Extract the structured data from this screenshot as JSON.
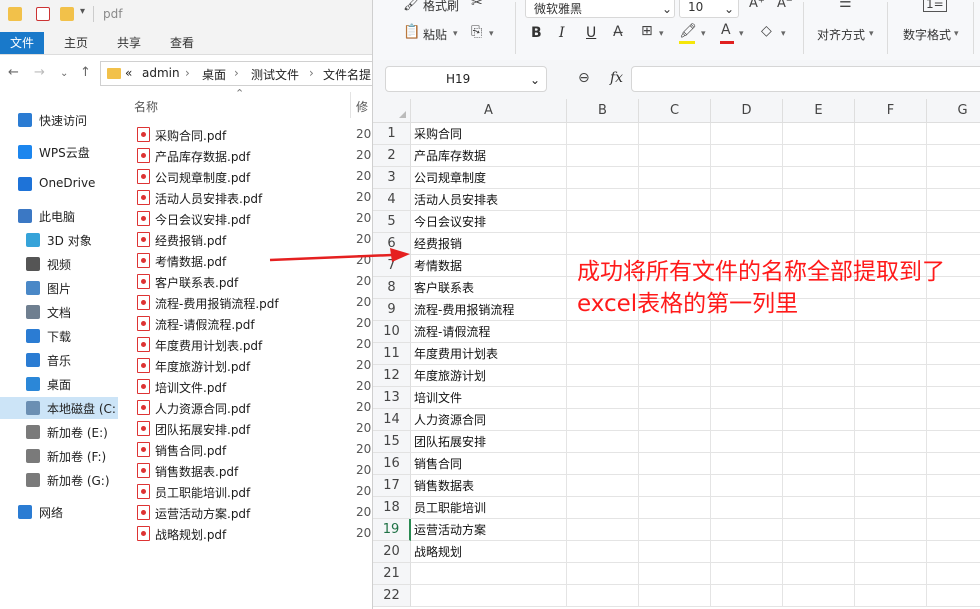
{
  "explorer": {
    "title": "pdf",
    "tabs": [
      "文件",
      "主页",
      "共享",
      "查看"
    ],
    "breadcrumbs": [
      "«",
      "admin",
      "›",
      "桌面",
      "›",
      "测试文件",
      "›",
      "文件名提"
    ],
    "column_name": "名称",
    "column_modified": "修",
    "nav": [
      {
        "label": "快速访问",
        "icon": "star-icon",
        "color": "#2b7cd3"
      },
      {
        "label": "WPS云盘",
        "icon": "cloud-icon",
        "color": "#1c86ee"
      },
      {
        "label": "OneDrive",
        "icon": "onedrive-icon",
        "color": "#1e73d8"
      },
      {
        "label": "此电脑",
        "icon": "computer-icon",
        "color": "#3b78c4"
      },
      {
        "label": "3D 对象",
        "icon": "cube-icon",
        "color": "#36a3d9"
      },
      {
        "label": "视频",
        "icon": "video-icon",
        "color": "#555555"
      },
      {
        "label": "图片",
        "icon": "picture-icon",
        "color": "#4a88c7"
      },
      {
        "label": "文档",
        "icon": "document-icon",
        "color": "#6f7f90"
      },
      {
        "label": "下载",
        "icon": "download-icon",
        "color": "#2b7cd3"
      },
      {
        "label": "音乐",
        "icon": "music-icon",
        "color": "#2b7cd3"
      },
      {
        "label": "桌面",
        "icon": "desktop-icon",
        "color": "#2b87d8"
      },
      {
        "label": "本地磁盘 (C:",
        "icon": "drive-icon",
        "color": "#6b8fb3"
      },
      {
        "label": "新加卷 (E:)",
        "icon": "drive-icon",
        "color": "#7a7a7a"
      },
      {
        "label": "新加卷 (F:)",
        "icon": "drive-icon",
        "color": "#7a7a7a"
      },
      {
        "label": "新加卷 (G:)",
        "icon": "drive-icon",
        "color": "#7a7a7a"
      },
      {
        "label": "网络",
        "icon": "network-icon",
        "color": "#2b7cd3"
      }
    ],
    "files": [
      {
        "name": "采购合同.pdf",
        "date": "20"
      },
      {
        "name": "产品库存数据.pdf",
        "date": "20"
      },
      {
        "name": "公司规章制度.pdf",
        "date": "20"
      },
      {
        "name": "活动人员安排表.pdf",
        "date": "20"
      },
      {
        "name": "今日会议安排.pdf",
        "date": "20"
      },
      {
        "name": "经费报销.pdf",
        "date": "20"
      },
      {
        "name": "考情数据.pdf",
        "date": "20"
      },
      {
        "name": "客户联系表.pdf",
        "date": "20"
      },
      {
        "name": "流程-费用报销流程.pdf",
        "date": "20"
      },
      {
        "name": "流程-请假流程.pdf",
        "date": "20"
      },
      {
        "name": "年度费用计划表.pdf",
        "date": "20"
      },
      {
        "name": "年度旅游计划.pdf",
        "date": "20"
      },
      {
        "name": "培训文件.pdf",
        "date": "20"
      },
      {
        "name": "人力资源合同.pdf",
        "date": "20"
      },
      {
        "name": "团队拓展安排.pdf",
        "date": "20"
      },
      {
        "name": "销售合同.pdf",
        "date": "20"
      },
      {
        "name": "销售数据表.pdf",
        "date": "20"
      },
      {
        "name": "员工职能培训.pdf",
        "date": "20"
      },
      {
        "name": "运营活动方案.pdf",
        "date": "20"
      },
      {
        "name": "战略规划.pdf",
        "date": "20"
      }
    ]
  },
  "toolbar": {
    "format_painter": "格式刷",
    "paste": "粘贴",
    "font_name": "微软雅黑",
    "font_size": "10",
    "align": "对齐方式",
    "number_format": "数字格式",
    "bold": "B",
    "italic": "I",
    "underline": "U"
  },
  "formula": {
    "name_box": "H19",
    "fx": "fx"
  },
  "sheet": {
    "columns": [
      "A",
      "B",
      "C",
      "D",
      "E",
      "F",
      "G"
    ],
    "rows": [
      "1",
      "2",
      "3",
      "4",
      "5",
      "6",
      "7",
      "8",
      "9",
      "10",
      "11",
      "12",
      "13",
      "14",
      "15",
      "16",
      "17",
      "18",
      "19",
      "20",
      "21",
      "22"
    ],
    "col_a_values": [
      "采购合同",
      "产品库存数据",
      "公司规章制度",
      "活动人员安排表",
      "今日会议安排",
      "经费报销",
      "考情数据",
      "客户联系表",
      "流程-费用报销流程",
      "流程-请假流程",
      "年度费用计划表",
      "年度旅游计划",
      "培训文件",
      "人力资源合同",
      "团队拓展安排",
      "销售合同",
      "销售数据表",
      "员工职能培训",
      "运营活动方案",
      "战略规划",
      "",
      ""
    ],
    "selected_row": "19"
  },
  "annotation": {
    "text": "成功将所有文件的名称全部提取到了excel表格的第一列里",
    "color": "#ff1a1a"
  }
}
